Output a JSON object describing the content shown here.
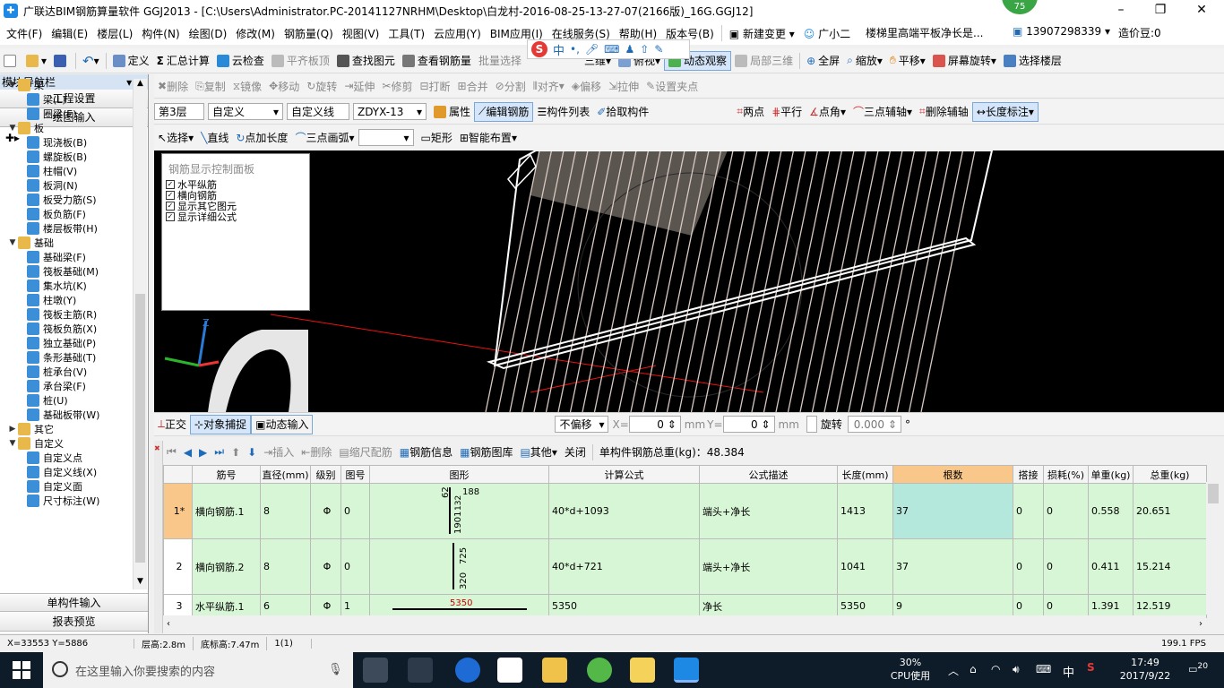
{
  "window": {
    "title": "广联达BIM钢筋算量软件 GGJ2013 - [C:\\Users\\Administrator.PC-20141127NRHM\\Desktop\\白龙村-2016-08-25-13-27-07(2166版)_16G.GGJ12]",
    "badge": "75",
    "controls": {
      "minimize": "–",
      "restore": "❐",
      "close": "✕"
    }
  },
  "menubar": {
    "items": [
      "文件(F)",
      "编辑(E)",
      "楼层(L)",
      "构件(N)",
      "绘图(D)",
      "修改(M)",
      "钢筋量(Q)",
      "视图(V)",
      "工具(T)",
      "云应用(Y)",
      "BIM应用(I)",
      "在线服务(S)",
      "帮助(H)",
      "版本号(B)"
    ],
    "new_change": "新建变更",
    "guangxiao": "广小二",
    "notice": "楼梯里高端平板净长是...",
    "phone": "13907298339",
    "coins": "造价豆:0"
  },
  "ime": {
    "logo": "S",
    "mode": "中"
  },
  "toolbar1": {
    "items": [
      "定义",
      "汇总计算",
      "云检查",
      "平齐板顶",
      "查找图元",
      "查看钢筋量",
      "批量选择"
    ],
    "view_items": [
      "三维",
      "俯视",
      "动态观察",
      "局部三维",
      "全屏",
      "缩放",
      "平移",
      "屏幕旋转",
      "选择楼层"
    ]
  },
  "toolbar2": {
    "items": [
      "删除",
      "复制",
      "镜像",
      "移动",
      "旋转",
      "延伸",
      "修剪",
      "打断",
      "合并",
      "分割",
      "对齐",
      "偏移",
      "拉伸",
      "设置夹点"
    ]
  },
  "toolbar3": {
    "floor": "第3层",
    "category": "自定义",
    "type": "自定义线",
    "element": "ZDYX-13",
    "buttons": [
      "属性",
      "编辑钢筋",
      "构件列表",
      "拾取构件"
    ],
    "aux": [
      "两点",
      "平行",
      "点角",
      "三点辅轴",
      "删除辅轴",
      "长度标注"
    ]
  },
  "toolbar4": {
    "items": [
      "选择",
      "直线",
      "点加长度",
      "三点画弧",
      "矩形",
      "智能布置"
    ]
  },
  "nav": {
    "header": "模块导航栏",
    "pin": "▾ ✕",
    "top_buttons": [
      "工程设置",
      "绘图输入"
    ],
    "bottom_buttons": [
      "单构件输入",
      "报表预览"
    ],
    "tree": [
      {
        "level": 0,
        "label": "梁",
        "exp": "▼",
        "folder": true
      },
      {
        "level": 1,
        "label": "梁(L)"
      },
      {
        "level": 1,
        "label": "圈梁(E)"
      },
      {
        "level": 0,
        "label": "板",
        "exp": "▼",
        "folder": true
      },
      {
        "level": 1,
        "label": "现浇板(B)"
      },
      {
        "level": 1,
        "label": "螺旋板(B)"
      },
      {
        "level": 1,
        "label": "柱帽(V)"
      },
      {
        "level": 1,
        "label": "板洞(N)"
      },
      {
        "level": 1,
        "label": "板受力筋(S)"
      },
      {
        "level": 1,
        "label": "板负筋(F)"
      },
      {
        "level": 1,
        "label": "楼层板带(H)"
      },
      {
        "level": 0,
        "label": "基础",
        "exp": "▼",
        "folder": true
      },
      {
        "level": 1,
        "label": "基础梁(F)"
      },
      {
        "level": 1,
        "label": "筏板基础(M)"
      },
      {
        "level": 1,
        "label": "集水坑(K)"
      },
      {
        "level": 1,
        "label": "柱墩(Y)"
      },
      {
        "level": 1,
        "label": "筏板主筋(R)"
      },
      {
        "level": 1,
        "label": "筏板负筋(X)"
      },
      {
        "level": 1,
        "label": "独立基础(P)"
      },
      {
        "level": 1,
        "label": "条形基础(T)"
      },
      {
        "level": 1,
        "label": "桩承台(V)"
      },
      {
        "level": 1,
        "label": "承台梁(F)"
      },
      {
        "level": 1,
        "label": "桩(U)"
      },
      {
        "level": 1,
        "label": "基础板带(W)"
      },
      {
        "level": 0,
        "label": "其它",
        "exp": "▶",
        "folder": true
      },
      {
        "level": 0,
        "label": "自定义",
        "exp": "▼",
        "folder": true
      },
      {
        "level": 1,
        "label": "自定义点"
      },
      {
        "level": 1,
        "label": "自定义线(X)"
      },
      {
        "level": 1,
        "label": "自定义面"
      },
      {
        "level": 1,
        "label": "尺寸标注(W)"
      }
    ]
  },
  "rebar_panel": {
    "title": "钢筋显示控制面板",
    "options": [
      "水平纵筋",
      "横向钢筋",
      "显示其它图元",
      "显示详细公式"
    ]
  },
  "snapbar": {
    "ortho": "正交",
    "snap": "对象捕捉",
    "dyn": "动态输入",
    "offset_mode": "不偏移",
    "x_label": "X=",
    "x_value": "0",
    "y_label": "Y=",
    "y_value": "0",
    "unit": "mm",
    "rotate": "旋转",
    "angle": "0.000",
    "deg": "°"
  },
  "rebar_toolbar": {
    "items": [
      "插入",
      "删除",
      "缩尺配筋",
      "钢筋信息",
      "钢筋图库",
      "其他",
      "关闭"
    ],
    "total": "单构件钢筋总重(kg)：48.384"
  },
  "table": {
    "headers": [
      "",
      "筋号",
      "直径(mm)",
      "级别",
      "图号",
      "图形",
      "计算公式",
      "公式描述",
      "长度(mm)",
      "根数",
      "搭接",
      "损耗(%)",
      "单重(kg)",
      "总重(kg)"
    ],
    "rows": [
      {
        "idx": "1*",
        "name": "横向钢筋.1",
        "dia": "8",
        "grade": "Φ",
        "fig": "0",
        "shape_a": "188",
        "shape_b": "62",
        "shape_c": "1901",
        "shape_d": "132",
        "formula": "40*d+1093",
        "desc": "端头+净长",
        "len": "1413",
        "count": "37",
        "lap": "0",
        "loss": "0",
        "unit": "0.558",
        "total": "20.651"
      },
      {
        "idx": "2",
        "name": "横向钢筋.2",
        "dia": "8",
        "grade": "Φ",
        "fig": "0",
        "shape_a": "725",
        "shape_b": "320",
        "shape_c": "",
        "shape_d": "",
        "formula": "40*d+721",
        "desc": "端头+净长",
        "len": "1041",
        "count": "37",
        "lap": "0",
        "loss": "0",
        "unit": "0.411",
        "total": "15.214"
      },
      {
        "idx": "3",
        "name": "水平纵筋.1",
        "dia": "6",
        "grade": "Φ",
        "fig": "1",
        "shape_a": "5350",
        "shape_b": "",
        "shape_c": "",
        "shape_d": "",
        "formula": "5350",
        "desc": "净长",
        "len": "5350",
        "count": "9",
        "lap": "0",
        "loss": "0",
        "unit": "1.391",
        "total": "12.519"
      }
    ]
  },
  "status": {
    "coords": "X=33553 Y=5886",
    "floor_height": "层高:2.8m",
    "bottom_elev": "底标高:7.47m",
    "sel": "1(1)",
    "fps": "199.1 FPS"
  },
  "taskbar": {
    "search_placeholder": "在这里输入你要搜索的内容",
    "cpu_percent": "30%",
    "cpu_label": "CPU使用",
    "ime": "中",
    "time": "17:49",
    "date": "2017/9/22",
    "notif": "20"
  }
}
